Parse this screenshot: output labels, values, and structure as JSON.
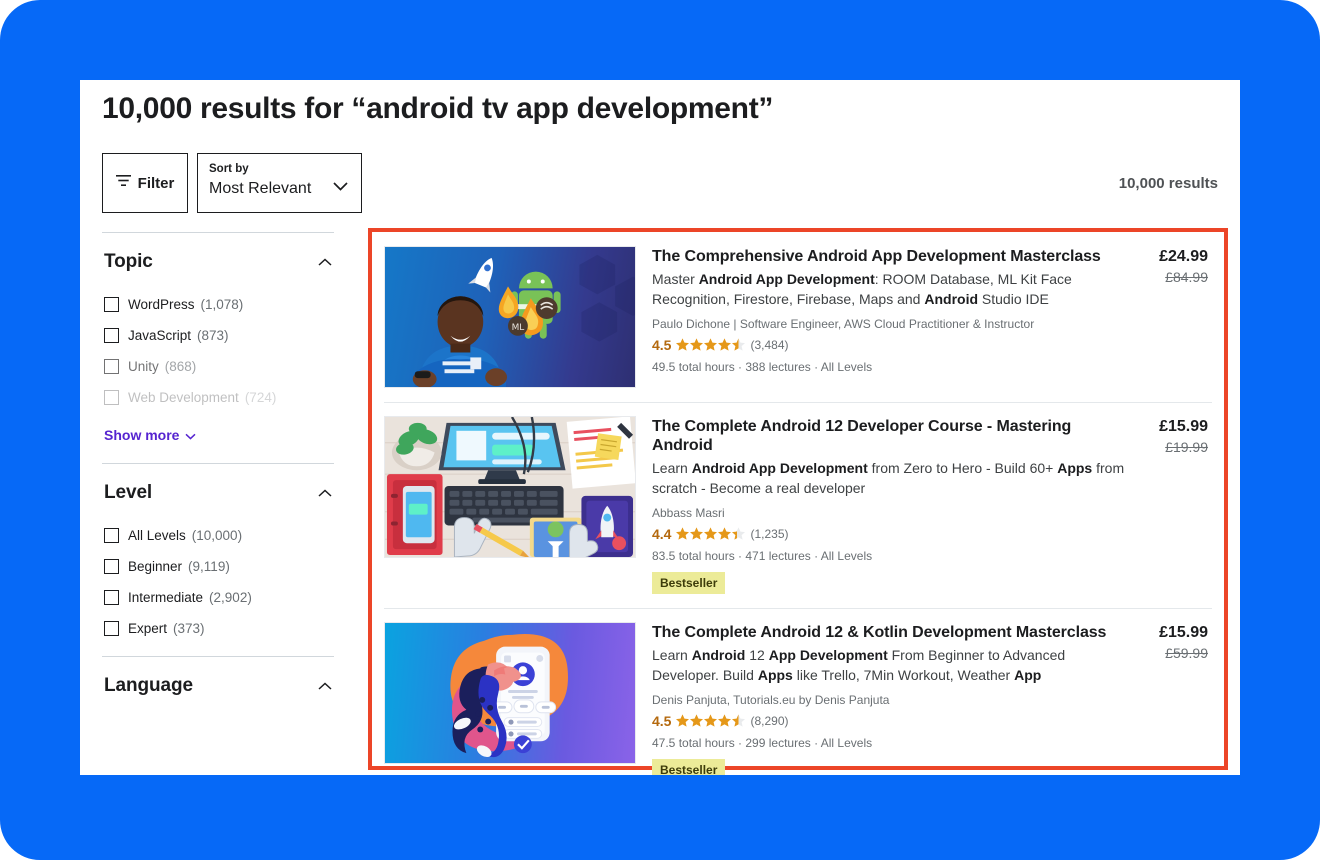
{
  "header": {
    "title": "10,000 results for “android tv app development”",
    "results_count": "10,000 results"
  },
  "toolbar": {
    "filter_label": "Filter",
    "filter_icon": "filter-icon",
    "sort_label": "Sort by",
    "sort_value": "Most Relevant",
    "sort_chevron_icon": "chevron-down-icon"
  },
  "sidebar": {
    "facets": [
      {
        "title": "Topic",
        "collapse_icon": "chevron-up-icon",
        "options": [
          {
            "label": "WordPress",
            "count": "(1,078)",
            "checked": false
          },
          {
            "label": "JavaScript",
            "count": "(873)",
            "checked": false
          },
          {
            "label": "Unity",
            "count": "(868)",
            "checked": false
          },
          {
            "label": "Web Development",
            "count": "(724)",
            "checked": false
          }
        ],
        "show_more": "Show more",
        "show_more_icon": "chevron-down-icon"
      },
      {
        "title": "Level",
        "collapse_icon": "chevron-up-icon",
        "options": [
          {
            "label": "All Levels",
            "count": "(10,000)",
            "checked": false
          },
          {
            "label": "Beginner",
            "count": "(9,119)",
            "checked": false
          },
          {
            "label": "Intermediate",
            "count": "(2,902)",
            "checked": false
          },
          {
            "label": "Expert",
            "count": "(373)",
            "checked": false
          }
        ]
      },
      {
        "title": "Language",
        "collapse_icon": "chevron-up-icon",
        "options": []
      }
    ]
  },
  "results": {
    "highlight_color": "#ec4528",
    "courses": [
      {
        "title": "The Comprehensive Android App Development Masterclass",
        "desc_parts": [
          {
            "t": "Master ",
            "b": false
          },
          {
            "t": "Android App Development",
            "b": true
          },
          {
            "t": ": ROOM Database, ML Kit Face Recognition, Firestore, Firebase, Maps and ",
            "b": false
          },
          {
            "t": "Android",
            "b": true
          },
          {
            "t": " Studio IDE",
            "b": false
          }
        ],
        "author": "Paulo Dichone | Software Engineer, AWS Cloud Practitioner & Instructor",
        "rating": "4.5",
        "stars": 4.5,
        "rating_count": "(3,484)",
        "meta": "49.5 total hours · 388 lectures · All Levels",
        "badge": "",
        "price_now": "£24.99",
        "price_was": "£84.99",
        "thumb": "android-instructor-thumbnail"
      },
      {
        "title": "The Complete Android 12 Developer Course - Mastering Android",
        "desc_parts": [
          {
            "t": "Learn ",
            "b": false
          },
          {
            "t": "Android App Development",
            "b": true
          },
          {
            "t": " from Zero to Hero - Build 60+ ",
            "b": false
          },
          {
            "t": "Apps",
            "b": true
          },
          {
            "t": " from scratch - Become a real developer",
            "b": false
          }
        ],
        "author": "Abbass Masri",
        "rating": "4.4",
        "stars": 4.4,
        "rating_count": "(1,235)",
        "meta": "83.5 total hours · 471 lectures · All Levels",
        "badge": "Bestseller",
        "price_now": "£15.99",
        "price_was": "£19.99",
        "thumb": "desk-workspace-thumbnail"
      },
      {
        "title": "The Complete Android 12 & Kotlin Development Masterclass",
        "desc_parts": [
          {
            "t": "Learn ",
            "b": false
          },
          {
            "t": "Android",
            "b": true
          },
          {
            "t": " 12 ",
            "b": false
          },
          {
            "t": "App Development",
            "b": true
          },
          {
            "t": " From Beginner to Advanced Developer. Build ",
            "b": false
          },
          {
            "t": "Apps",
            "b": true
          },
          {
            "t": " like Trello, 7Min Workout, Weather ",
            "b": false
          },
          {
            "t": "App",
            "b": true
          }
        ],
        "author": "Denis Panjuta, Tutorials.eu by Denis Panjuta",
        "rating": "4.5",
        "stars": 4.5,
        "rating_count": "(8,290)",
        "meta": "47.5 total hours · 299 lectures · All Levels",
        "badge": "Bestseller",
        "price_now": "£15.99",
        "price_was": "£59.99",
        "thumb": "mobile-app-person-thumbnail"
      }
    ]
  },
  "colors": {
    "background": "#0669f7",
    "link": "#5624d0",
    "star": "#e59819",
    "rating_text": "#b4690e",
    "badge_bg": "#eceb98"
  }
}
